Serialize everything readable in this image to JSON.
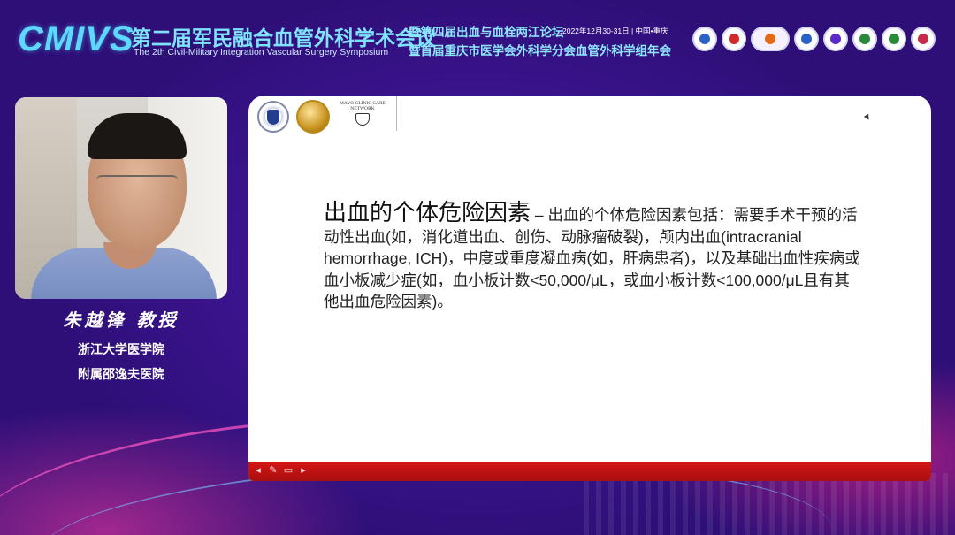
{
  "header": {
    "logo_text": "CMIVS",
    "title_cn": "第二届军民融合血管外科学术会议",
    "title_en": "The 2th Civil-Military Integration Vascular Surgery Symposium",
    "subtitle_1": "暨第四届出血与血栓两江论坛",
    "date_location": "2022年12月30-31日 | 中国•重庆",
    "subtitle_2": "暨首届重庆市医学会外科学分会血管外科学组年会",
    "badges": [
      {
        "icon": "society-emblem-1",
        "color": "#2a62c8"
      },
      {
        "icon": "society-emblem-2",
        "color": "#d12a2a"
      },
      {
        "icon": "society-emblem-3",
        "color": "#e46a1a"
      },
      {
        "icon": "society-emblem-4",
        "color": "#2a62c8"
      },
      {
        "icon": "society-emblem-5",
        "color": "#5a2ac8"
      },
      {
        "icon": "society-emblem-6",
        "color": "#2a8a3a"
      },
      {
        "icon": "society-emblem-7",
        "color": "#2a8a3a"
      },
      {
        "icon": "society-emblem-8",
        "color": "#c82a4a"
      }
    ]
  },
  "speaker": {
    "name": "朱越锋 教授",
    "affiliation_1": "浙江大学医学院",
    "affiliation_2": "附属邵逸夫医院"
  },
  "slide": {
    "mayo_text": "MAYO CLINIC CARE NETWORK",
    "heading": "出血的个体危险因素",
    "dash": " – ",
    "body": "出血的个体危险因素包括：需要手术干预的活动性出血(如，消化道出血、创伤、动脉瘤破裂)，颅内出血(intracranial hemorrhage, ICH)，中度或重度凝血病(如，肝病患者)，以及基础出血性疾病或血小板减少症(如，血小板计数<50,000/μL，或血小板计数<100,000/μL且有其他出血危险因素)。",
    "controls": [
      "◂",
      "✎",
      "▭",
      "▸"
    ]
  },
  "colors": {
    "background": "#3a148a",
    "accent_cyan": "#5fd8ff",
    "slide_bar": "#d51515"
  }
}
